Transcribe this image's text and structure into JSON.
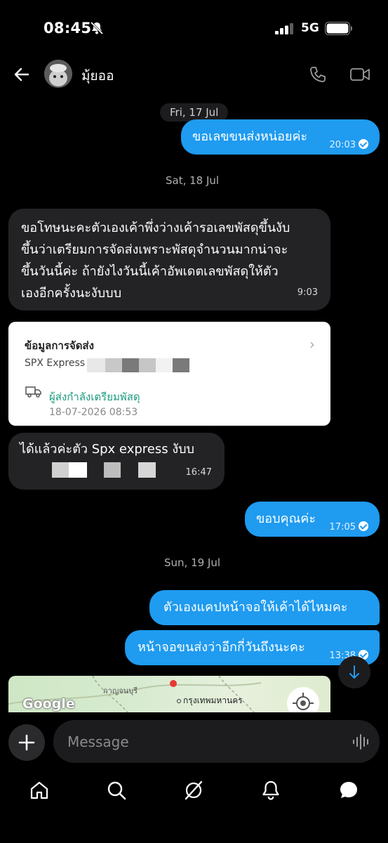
{
  "status_bar": {
    "time": "08:45",
    "network": "5G"
  },
  "header": {
    "contact_name": "มุ้ยออ"
  },
  "chat": {
    "dates": {
      "fri": "Fri, 17 Jul",
      "sat": "Sat, 18 Jul",
      "sun": "Sun, 19 Jul"
    },
    "messages": {
      "m1": {
        "text": "ขอเลขขนส่งหน่อยค่ะ",
        "time": "20:03"
      },
      "m2": {
        "lines": [
          "ขอโทษนะคะตัวเองเค้าพึ่งว่างเค้ารอเลขพัสดุขึ้นงับ",
          "ขึ้นว่าเตรียมการจัดส่งเพราะพัสดุจำนวนมากน่าจะ",
          "ขึ้นวันนี้ค่ะ ถ้ายังไงวันนี้เค้าอัพเดตเลขพัสดุให้ตัว",
          "เองอีกครั้งนะงับบบ"
        ],
        "time": "9:03"
      },
      "m3": {
        "text": "ได้แล้วค่ะตัว Spx express งับบ",
        "time": "16:47"
      },
      "m4": {
        "text": "ขอบคุณค่ะ",
        "time": "17:05"
      },
      "m5": {
        "text": "ตัวเองแคปหน้าจอให้เค้าได้ไหมคะ"
      },
      "m6": {
        "text": "หน้าจอขนส่งว่าอีกกี่วันถึงนะคะ",
        "time": "13:38"
      }
    },
    "shipment_card": {
      "title": "ข้อมูลการจัดส่ง",
      "carrier": "SPX Express",
      "status": "ผู้ส่งกำลังเตรียมพัสดุ",
      "timestamp": "18-07-2026 08:53"
    },
    "map": {
      "city_1": "กาญจนบุรี",
      "city_2": "กรุงเทพมหานคร",
      "logo": "Google"
    }
  },
  "composer": {
    "placeholder": "Message"
  },
  "tabs": [
    "home-icon",
    "search-icon",
    "grok-icon",
    "notifications-icon",
    "messages-icon"
  ]
}
